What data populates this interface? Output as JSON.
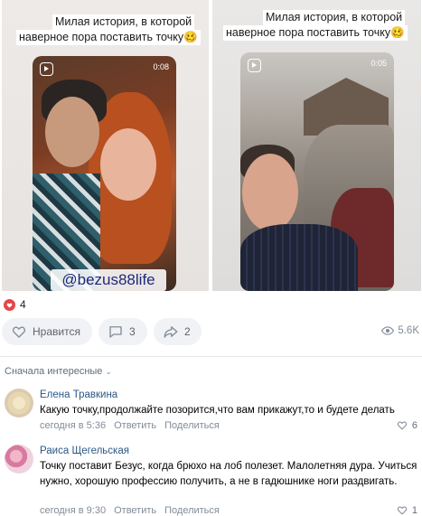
{
  "post": {
    "photo_left": {
      "caption_line1": "Милая история, в которой",
      "caption_line2": "наверное пора поставить точку🥴",
      "story_time": "0:08",
      "watermark": "@bezus88life"
    },
    "photo_right": {
      "caption_line1": "Милая история, в которой",
      "caption_line2": "наверное пора поставить точку🥴",
      "story_time": "0:05"
    },
    "reactions_count": "4",
    "actions": {
      "like_label": "Нравится",
      "comments_count": "3",
      "shares_count": "2",
      "views": "5.6K"
    }
  },
  "comments_section": {
    "sort_label": "Сначала интересные",
    "comments": [
      {
        "author": "Елена Травкина",
        "text": "Какую точку,продолжайте позорится,что вам прикажут,то и будете делать",
        "time": "сегодня в 5:36",
        "reply_label": "Ответить",
        "share_label": "Поделиться",
        "likes": "6"
      },
      {
        "author": "Раиса Щегельская",
        "text": "Точку поставит Безус, когда брюхо на лоб полезет. Малолетняя дура. Учиться нужно, хорошую профессию получить, а не в гадюшнике ноги раздвигать.",
        "time": "сегодня в 9:30",
        "reply_label": "Ответить",
        "share_label": "Поделиться",
        "likes": "1"
      }
    ]
  },
  "colors": {
    "link": "#2a5885",
    "muted": "#818c99",
    "heart": "#e64646",
    "pill_bg": "#f0f2f5"
  }
}
